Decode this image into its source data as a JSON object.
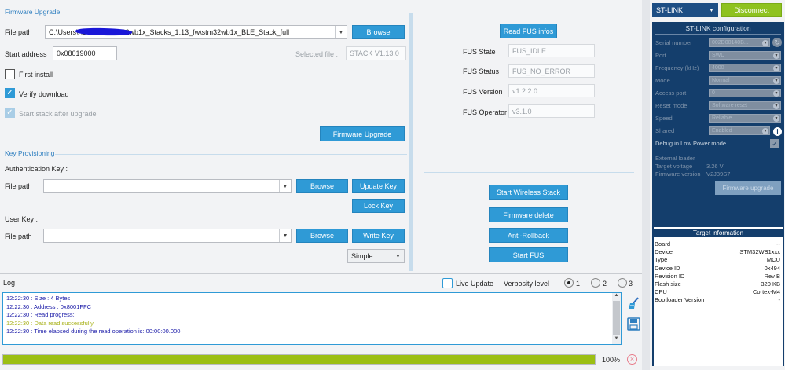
{
  "fw": {
    "section": "Firmware Upgrade",
    "file_path_label": "File path",
    "file_path_value": "C:\\Users\\                    \\Desktop\\stm32wb1x_Stacks_1.13_fw\\stm32wb1x_BLE_Stack_full",
    "browse": "Browse",
    "start_address_label": "Start address",
    "start_address_value": "0x08019000",
    "selected_file_label": "Selected file :",
    "selected_file_value": "STACK V1.13.0",
    "first_install": "First install",
    "verify_download": "Verify download",
    "start_stack": "Start stack after upgrade",
    "upgrade_button": "Firmware Upgrade"
  },
  "key": {
    "section": "Key Provisioning",
    "auth_label": "Authentication Key :",
    "file_path_label": "File path",
    "browse": "Browse",
    "update_key": "Update Key",
    "lock_key": "Lock Key",
    "user_label": "User Key :",
    "file_path_label2": "File path",
    "browse2": "Browse",
    "write_key": "Write Key",
    "mode_value": "Simple"
  },
  "fus": {
    "read_button": "Read FUS infos",
    "state_label": "FUS State",
    "state_value": "FUS_IDLE",
    "status_label": "FUS Status",
    "status_value": "FUS_NO_ERROR",
    "version_label": "FUS Version",
    "version_value": "v1.2.2.0",
    "operator_label": "FUS Operator",
    "operator_value": "v3.1.0",
    "start_wireless": "Start Wireless Stack",
    "firmware_delete": "Firmware delete",
    "anti_rollback": "Anti-Rollback",
    "start_fus": "Start FUS"
  },
  "stlink": {
    "device_select": "ST-LINK",
    "disconnect": "Disconnect",
    "config_title": "ST-LINK configuration",
    "serial_label": "Serial number",
    "serial_value": "002D00140B...",
    "port_label": "Port",
    "port_value": "SWD",
    "freq_label": "Frequency (kHz)",
    "freq_value": "4000",
    "mode_label": "Mode",
    "mode_value": "Normal",
    "ap_label": "Access port",
    "ap_value": "0",
    "reset_label": "Reset mode",
    "reset_value": "Software reset",
    "speed_label": "Speed",
    "speed_value": "Reliable",
    "shared_label": "Shared",
    "shared_value": "Enabled",
    "debug_label": "Debug in Low Power mode",
    "ext_loader": "External loader",
    "target_voltage_label": "Target voltage",
    "target_voltage_value": "3.26 V",
    "fw_version_label": "Firmware version",
    "fw_version_value": "V2J39S7",
    "fw_upgrade": "Firmware upgrade"
  },
  "target": {
    "title": "Target information",
    "rows": [
      {
        "k": "Board",
        "v": "--"
      },
      {
        "k": "Device",
        "v": "STM32WB1xxx"
      },
      {
        "k": "Type",
        "v": "MCU"
      },
      {
        "k": "Device ID",
        "v": "0x494"
      },
      {
        "k": "Revision ID",
        "v": "Rev B"
      },
      {
        "k": "Flash size",
        "v": "320 KB"
      },
      {
        "k": "CPU",
        "v": "Cortex-M4"
      },
      {
        "k": "Bootloader Version",
        "v": "-"
      }
    ]
  },
  "log": {
    "title": "Log",
    "live_update": "Live Update",
    "verbosity_label": "Verbosity level",
    "levels": [
      "1",
      "2",
      "3"
    ],
    "lines": [
      {
        "t": "12:22:30 :   Size          : 4 Bytes",
        "c": "#1a1aa8"
      },
      {
        "t": "12:22:30 :   Address     : 0x8001FFC",
        "c": "#1a1aa8"
      },
      {
        "t": "12:22:30 : Read progress:",
        "c": "#1a1aa8"
      },
      {
        "t": "12:22:30 : Data read successfully",
        "c": "#a8b11a"
      },
      {
        "t": "12:22:30 : Time elapsed during the read operation is: 00:00:00.000",
        "c": "#1a1aa8"
      }
    ],
    "progress": 1.0,
    "progress_text": "100%"
  },
  "icons": {
    "broom": "broom-icon",
    "save": "save-icon",
    "cancel": "cancel-icon",
    "info": "info-icon"
  }
}
